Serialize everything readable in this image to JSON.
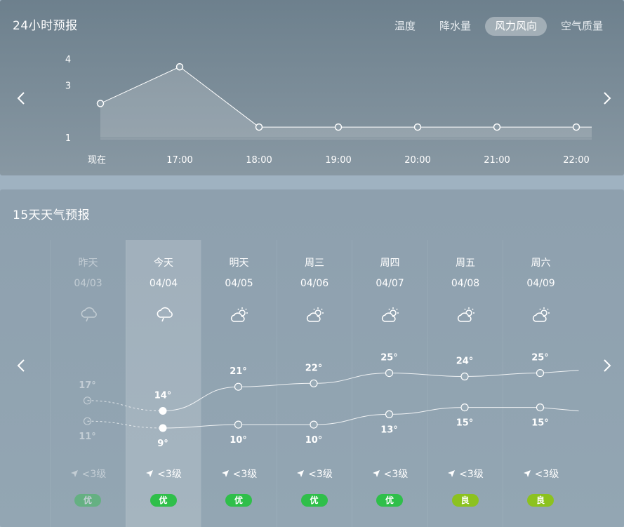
{
  "hourly": {
    "title": "24小时预报",
    "tabs": [
      {
        "label": "温度",
        "active": false
      },
      {
        "label": "降水量",
        "active": false
      },
      {
        "label": "风力风向",
        "active": true
      },
      {
        "label": "空气质量",
        "active": false
      }
    ],
    "chart_data": {
      "type": "area",
      "categories": [
        "现在",
        "17:00",
        "18:00",
        "19:00",
        "20:00",
        "21:00",
        "22:00"
      ],
      "values": [
        2.3,
        3.7,
        1.4,
        1.4,
        1.4,
        1.4,
        1.4
      ],
      "y_ticks": [
        "4",
        "3",
        "1"
      ],
      "ylim": [
        1,
        4
      ],
      "grid": false
    }
  },
  "daily": {
    "title": "15天天气预报",
    "days": [
      {
        "name": "昨天",
        "date": "04/03",
        "icon": "rain-cloud-icon",
        "high": "17°",
        "low": "11°",
        "wind": "<3级",
        "aqi": "优",
        "aqi_color": "#2fbf4a",
        "past": true
      },
      {
        "name": "今天",
        "date": "04/04",
        "icon": "rain-cloud-icon",
        "high": "14°",
        "low": "9°",
        "wind": "<3级",
        "aqi": "优",
        "aqi_color": "#2fbf4a",
        "today": true
      },
      {
        "name": "明天",
        "date": "04/05",
        "icon": "partly-sunny-icon",
        "high": "21°",
        "low": "10°",
        "wind": "<3级",
        "aqi": "优",
        "aqi_color": "#2fbf4a"
      },
      {
        "name": "周三",
        "date": "04/06",
        "icon": "partly-sunny-icon",
        "high": "22°",
        "low": "10°",
        "wind": "<3级",
        "aqi": "优",
        "aqi_color": "#2fbf4a"
      },
      {
        "name": "周四",
        "date": "04/07",
        "icon": "partly-sunny-icon",
        "high": "25°",
        "low": "13°",
        "wind": "<3级",
        "aqi": "优",
        "aqi_color": "#2fbf4a"
      },
      {
        "name": "周五",
        "date": "04/08",
        "icon": "partly-sunny-icon",
        "high": "24°",
        "low": "15°",
        "wind": "<3级",
        "aqi": "良",
        "aqi_color": "#8cc21f"
      },
      {
        "name": "周六",
        "date": "04/09",
        "icon": "partly-sunny-icon",
        "high": "25°",
        "low": "15°",
        "wind": "<3级",
        "aqi": "良",
        "aqi_color": "#8cc21f"
      }
    ],
    "chart_data": {
      "type": "line",
      "categories": [
        "04/03",
        "04/04",
        "04/05",
        "04/06",
        "04/07",
        "04/08",
        "04/09"
      ],
      "series": [
        {
          "values": [
            17,
            14,
            21,
            22,
            25,
            24,
            25
          ]
        },
        {
          "values": [
            11,
            9,
            10,
            10,
            13,
            15,
            15
          ]
        }
      ]
    }
  }
}
